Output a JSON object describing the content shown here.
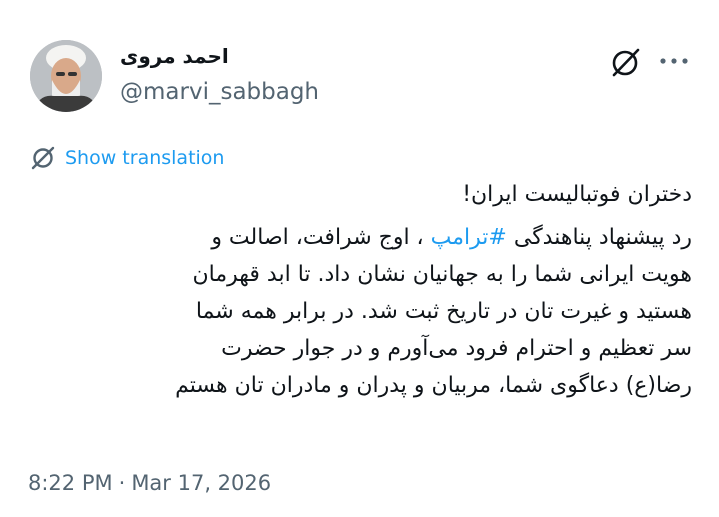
{
  "author": {
    "display_name": "احمد مروی",
    "handle": "@marvi_sabbagh"
  },
  "icons": {
    "grok": "grok-slash-icon",
    "more": "more-dots-icon",
    "translate": "translate-icon"
  },
  "translation": {
    "label": "Show translation"
  },
  "tweet": {
    "line1": "دختران فوتبالیست ایران!",
    "line2_prefix": "رد پیشنهاد پناهندگی ",
    "hashtag": "#ترامپ",
    "line2_suffix": " ، اوج شرافت، اصالت و",
    "line3": "هویت ایرانی شما را به جهانیان نشان داد. تا ابد قهرمان",
    "line4": "هستید و غیرت تان در تاریخ ثبت شد. در برابر همه شما",
    "line5": "سر تعظیم و احترام فرود می‌آورم و در جوار حضرت",
    "line6": "رضا(ع) دعاگوی شما، مربیان و پدران و مادران تان هستم"
  },
  "meta": {
    "time": "8:22 PM",
    "separator": "·",
    "date": "Mar 17, 2026"
  },
  "colors": {
    "accent": "#1d9bf0",
    "secondary_text": "#536471",
    "primary_text": "#0f1419"
  }
}
